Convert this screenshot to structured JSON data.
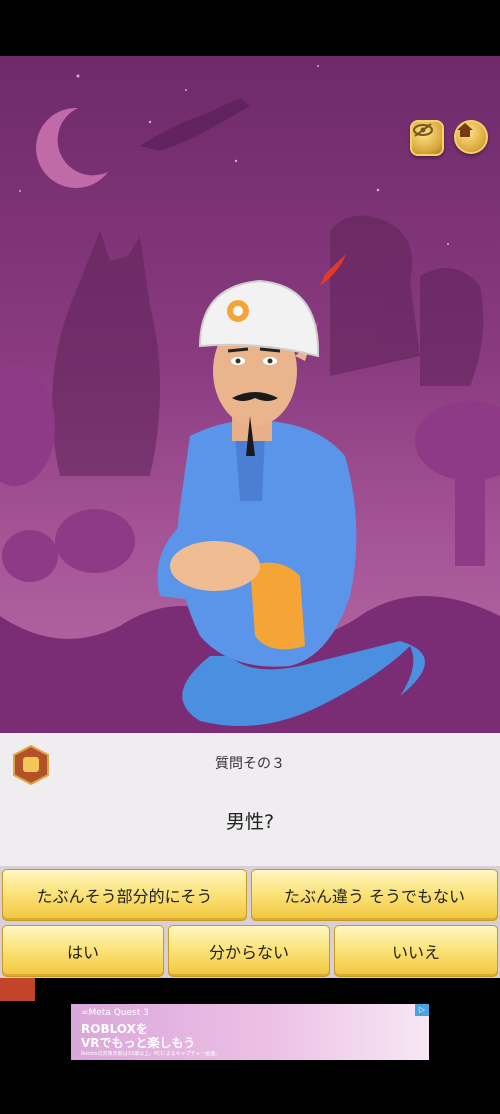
{
  "header": {
    "hide_icon": "eye-slash-icon",
    "home_icon": "home-icon"
  },
  "question": {
    "number_label": "質問その３",
    "text": "男性?"
  },
  "answers": {
    "probably": "たぶんそう部分的にそう",
    "probably_not": "たぶん違う そうでもない",
    "yes": "はい",
    "dont_know": "分からない",
    "no": "いいえ"
  },
  "progress": {
    "fraction": 0.07
  },
  "ad": {
    "brand": "∞Meta Quest 3",
    "headline_1": "ROBLOXを",
    "headline_2": "VRでもっと楽しもう",
    "fine_print": "Robloxの対象年齢は13歳以上。PCによるキャプチャー画面。",
    "badge": "▷"
  },
  "colors": {
    "scene_top": "#6e2a6a",
    "button_gold": "#f2c63d",
    "progress": "#c2452b"
  }
}
